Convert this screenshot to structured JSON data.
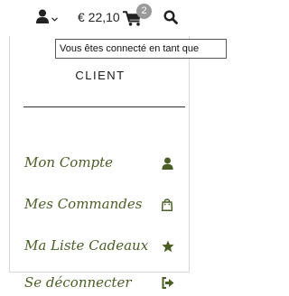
{
  "colors": {
    "accent": "#4a5e26",
    "text": "#222222",
    "badge": "#9a9a9a"
  },
  "header": {
    "user_icon": "user-icon",
    "dropdown_icon": "chevron-down-icon",
    "cart_total": "€ 22,10",
    "cart_icon": "cart-icon",
    "cart_count": "2",
    "search_icon": "search-icon"
  },
  "tooltip": {
    "text": "Vous êtes connecté en tant que"
  },
  "menu": {
    "title": "CLIENT",
    "items": [
      {
        "label": "Mon Compte",
        "icon": "user-icon"
      },
      {
        "label": "Mes Commandes",
        "icon": "shopping-bag-icon"
      },
      {
        "label": "Ma Liste Cadeaux",
        "icon": "star-icon"
      },
      {
        "label": "Se déconnecter",
        "icon": "sign-out-icon"
      }
    ]
  }
}
